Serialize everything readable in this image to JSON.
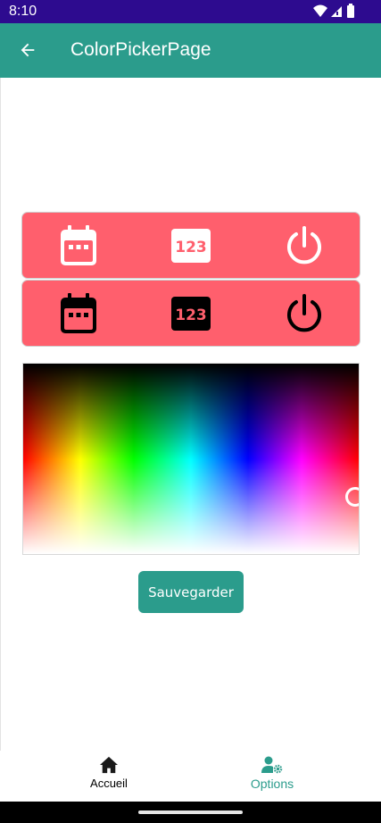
{
  "status_bar": {
    "time": "8:10",
    "icons": [
      "wifi-icon",
      "signal-icon",
      "battery-icon"
    ],
    "background": "#2d0b8f"
  },
  "app_bar": {
    "title": "ColorPickerPage",
    "back_icon": "arrow-left-icon",
    "background": "#2b9c8c"
  },
  "icon_rows": [
    {
      "background": "#ff5f6d",
      "icon_color": "#ffffff",
      "icons": [
        {
          "name": "calendar-icon"
        },
        {
          "name": "numeric-icon",
          "text": "123"
        },
        {
          "name": "power-icon"
        }
      ]
    },
    {
      "background": "#ff5f6d",
      "icon_color": "#000000",
      "icons": [
        {
          "name": "calendar-icon"
        },
        {
          "name": "numeric-icon",
          "text": "123"
        },
        {
          "name": "power-icon"
        }
      ]
    }
  ],
  "color_picker": {
    "type": "hue-lightness spectrum",
    "selected_hue": "red"
  },
  "actions": {
    "save_label": "Sauvegarder",
    "accent": "#2b9c8c"
  },
  "bottom_nav": {
    "items": [
      {
        "label": "Accueil",
        "icon": "home-icon",
        "active": false
      },
      {
        "label": "Options",
        "icon": "user-settings-icon",
        "active": true
      }
    ],
    "active_color": "#2b9c8c"
  }
}
